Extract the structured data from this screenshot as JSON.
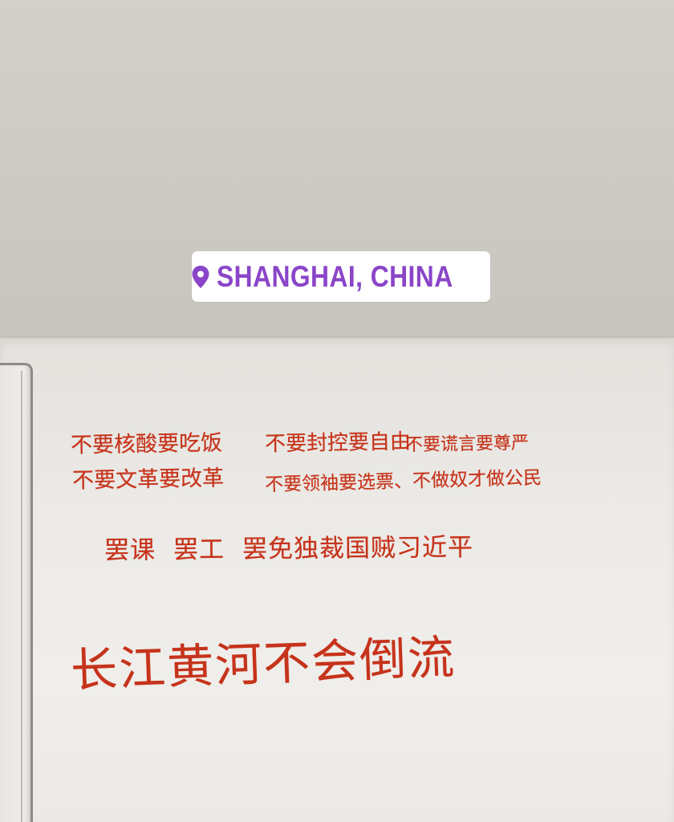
{
  "location_sticker": {
    "text": "SHANGHAI, CHINA",
    "icon": "location-pin-icon",
    "text_color": "#8a45c8",
    "background": "#ffffff"
  },
  "handwriting": {
    "ink_color": "#c6331b",
    "line_1": [
      "不要核酸要吃饭",
      "不要封控要自由",
      "不要谎言要尊严"
    ],
    "line_2": [
      "不要文革要改革",
      "不要领袖要选票、不做奴才做公民"
    ],
    "line_3": [
      "罢课",
      "罢工",
      "罢免独裁国贼习近平"
    ],
    "line_4": "长江黄河不会倒流"
  }
}
